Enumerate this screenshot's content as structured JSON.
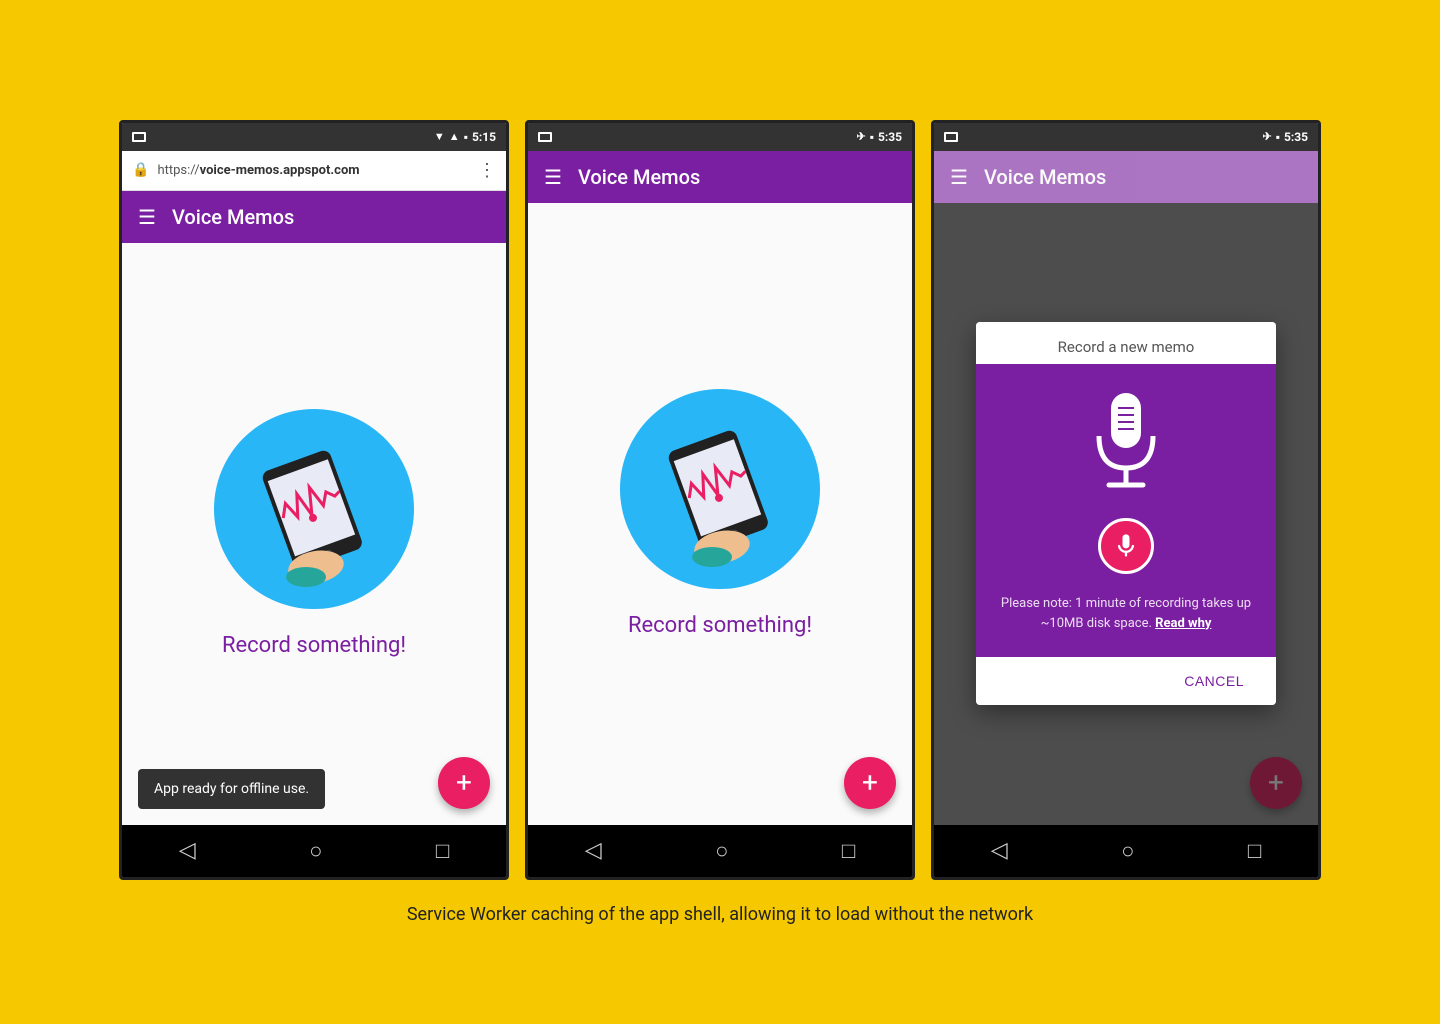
{
  "page": {
    "background_color": "#F5C800",
    "caption": "Service Worker caching of the app shell, allowing it to load without the network"
  },
  "phone1": {
    "status_bar": {
      "time": "5:15",
      "background": "#333"
    },
    "url_bar": {
      "url": "https://voice-memos.appspot.com",
      "url_prefix": "https://",
      "url_domain": "voice-memos.appspot.com"
    },
    "toolbar": {
      "title": "Voice Memos"
    },
    "content": {
      "record_text": "Record something!"
    },
    "snackbar": {
      "text": "App ready for offline use."
    },
    "fab_label": "+",
    "nav": {
      "back": "◁",
      "home": "○",
      "recent": "□"
    }
  },
  "phone2": {
    "status_bar": {
      "time": "5:35"
    },
    "toolbar": {
      "title": "Voice Memos"
    },
    "content": {
      "record_text": "Record something!"
    },
    "fab_label": "+",
    "nav": {
      "back": "◁",
      "home": "○",
      "recent": "□"
    }
  },
  "phone3": {
    "status_bar": {
      "time": "5:35"
    },
    "toolbar": {
      "title": "Voice Memos"
    },
    "dialog": {
      "title": "Record a new memo",
      "note": "Please note: 1 minute of recording takes up ~10MB disk space.",
      "note_link": "Read why",
      "cancel_label": "CANCEL"
    },
    "fab_label": "+",
    "nav": {
      "back": "◁",
      "home": "○",
      "recent": "□"
    }
  }
}
